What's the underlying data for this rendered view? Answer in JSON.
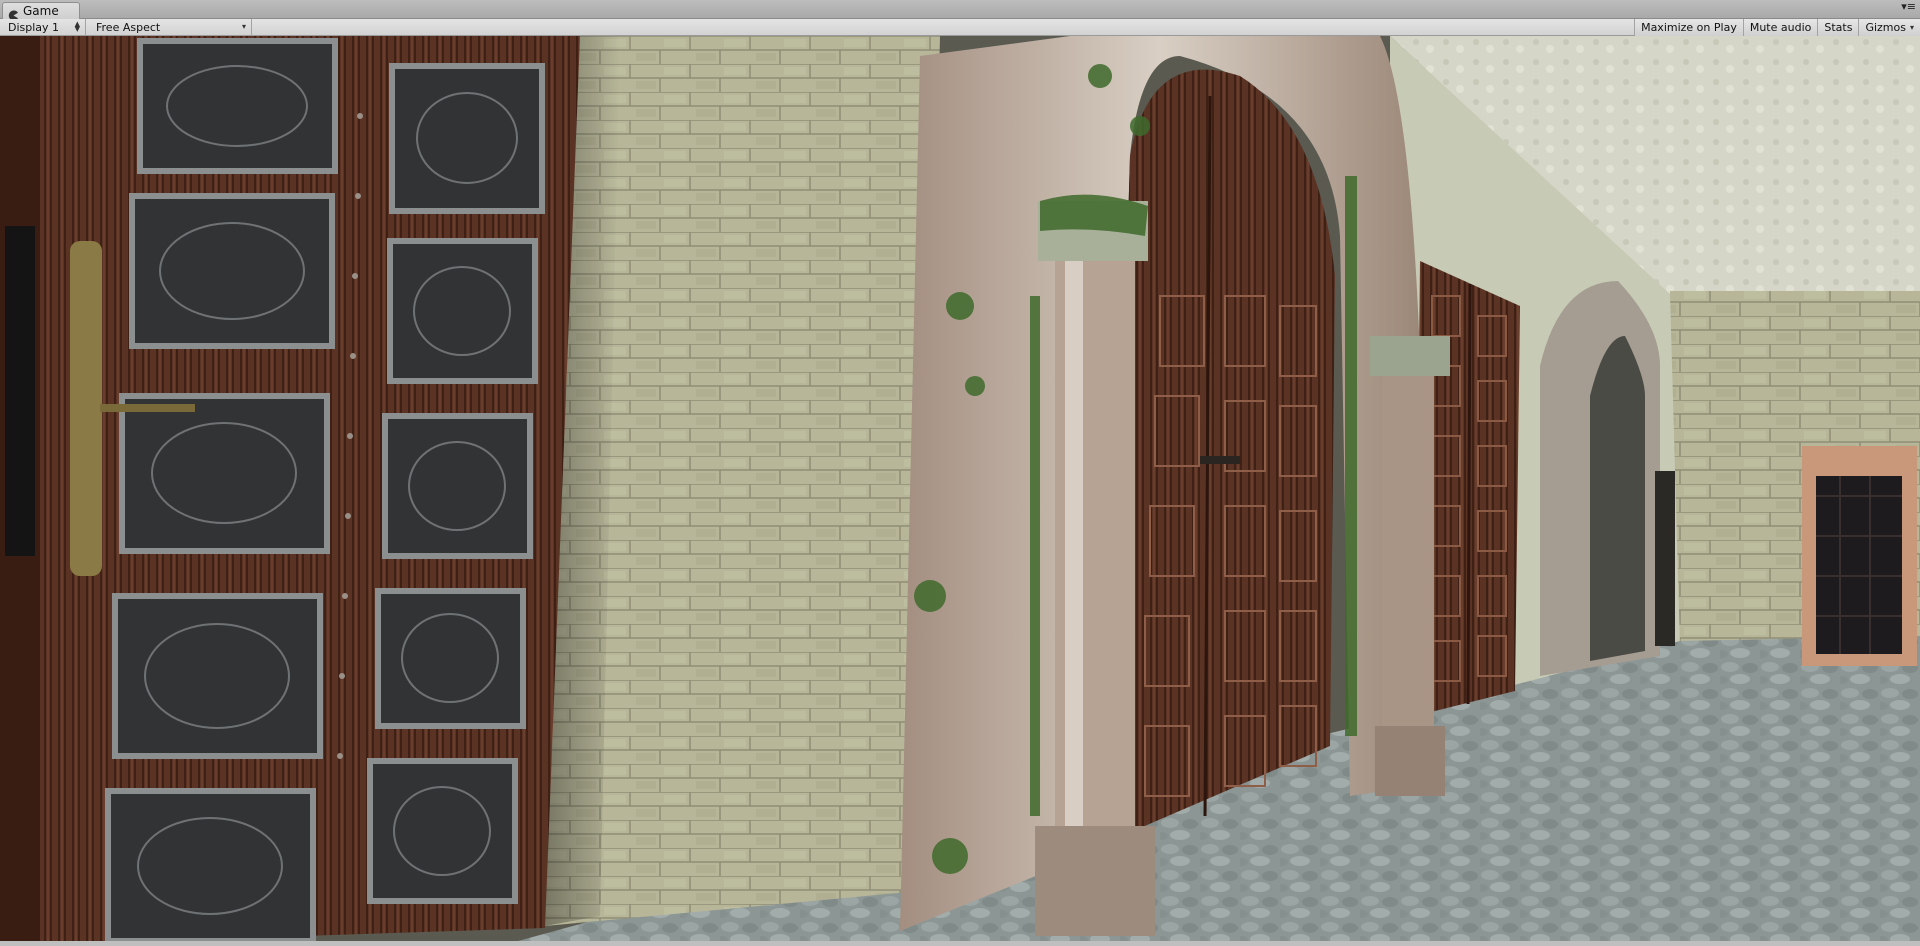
{
  "window": {
    "tab_title": "Game",
    "tab_icon": "game-pacman-icon",
    "menu_icon": "window-menu-icon"
  },
  "toolbar": {
    "display_select": "Display 1",
    "aspect_select": "Free Aspect",
    "maximize_on_play": "Maximize on Play",
    "mute_audio": "Mute audio",
    "stats": "Stats",
    "gizmos": "Gizmos"
  },
  "colors": {
    "chrome_bg": "#c2c2c2",
    "toolbar_bg": "#dcdcdc",
    "wood_door": "#5a3325",
    "stone_wall": "#b8b89a",
    "floor": "#8d9896",
    "ceiling": "#d8d8cc",
    "moss": "#3f6a2c"
  },
  "scene": {
    "description_icons": [
      "wooden-door-left",
      "stone-brick-wall",
      "gothic-stone-arch",
      "wooden-double-door",
      "corridor-far-door",
      "cobblestone-floor"
    ]
  }
}
